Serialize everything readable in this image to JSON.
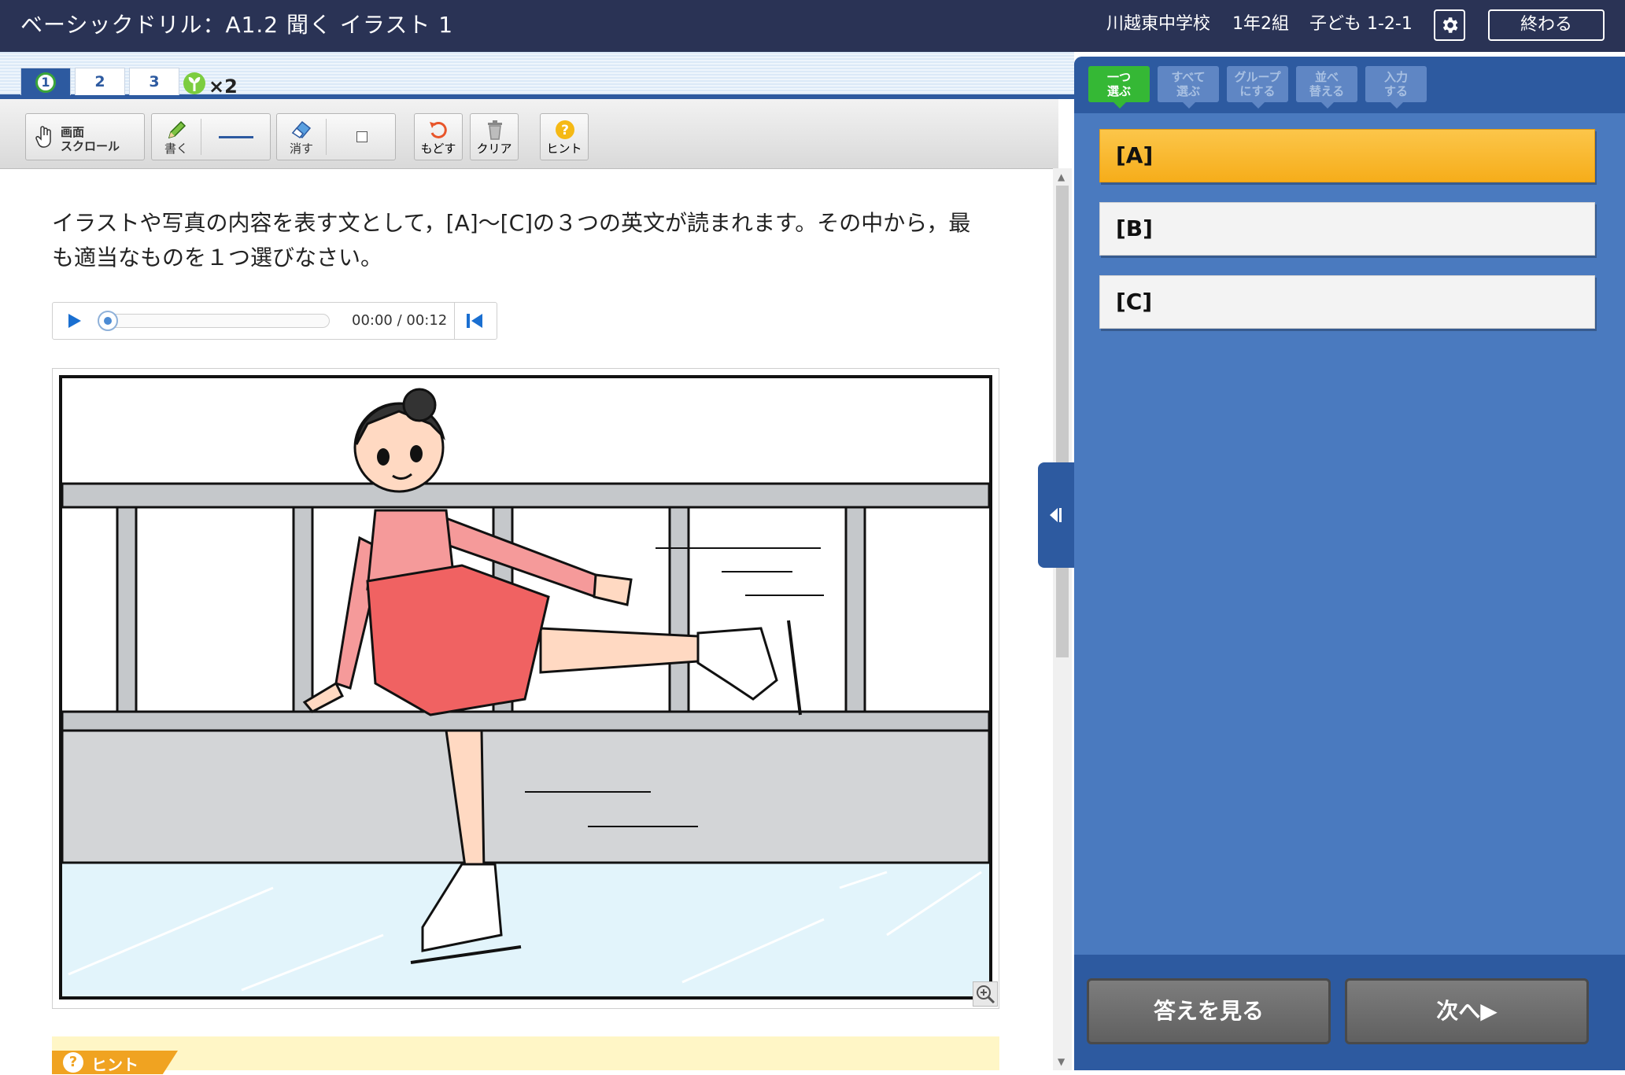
{
  "window": {
    "title": "ベーシックドリル：A1.2 聞く イラスト 1",
    "school": "川越東中学校",
    "class_name": "1年2組",
    "student": "子ども 1-2-1",
    "end_label": "終わる"
  },
  "tabs": [
    "1",
    "2",
    "3"
  ],
  "active_tab": 0,
  "sprout_count": "×2",
  "toolbar": {
    "scroll_label_1": "画面",
    "scroll_label_2": "スクロール",
    "write_label": "書く",
    "erase_label": "消す",
    "undo_label": "もどす",
    "clear_label": "クリア",
    "hint_label": "ヒント"
  },
  "question": {
    "text": "イラストや写真の内容を表す文として，[A]～[C]の３つの英文が読まれます。その中から，最も適当なものを１つ選びなさい。"
  },
  "player": {
    "time": "00:00 / 00:12",
    "progress": 0
  },
  "hint_tag_label": "ヒント",
  "right_panel": {
    "modes": [
      "一つ\n選ぶ",
      "すべて\n選ぶ",
      "グループ\nにする",
      "並べ\n替える",
      "入力\nする"
    ],
    "active_mode": 0,
    "choices": [
      "[A]",
      "[B]",
      "[C]"
    ],
    "selected_choice": 0,
    "show_answer_label": "答えを見る",
    "next_label": "次へ▶"
  },
  "colors": {
    "title_bar": "#2a3355",
    "panel": "#4a7abf",
    "panel_dark": "#2d5aa0",
    "selected_choice": "#f6ad1a",
    "active_mode": "#35b835"
  }
}
